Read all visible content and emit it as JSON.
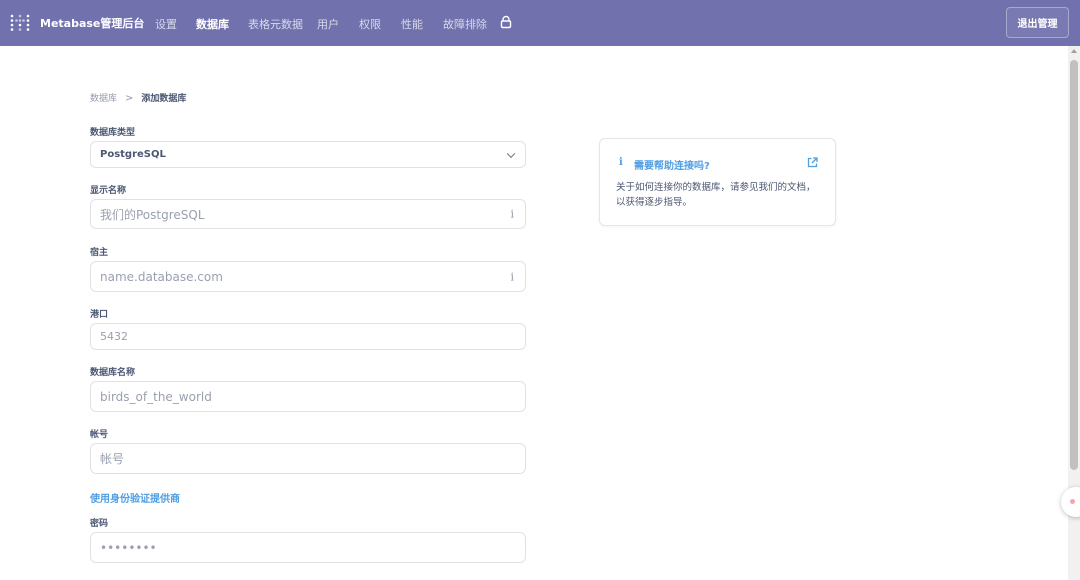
{
  "nav": {
    "brand": "Metabase管理后台",
    "items": [
      {
        "label": "设置",
        "active": false
      },
      {
        "label": "数据库",
        "active": true
      },
      {
        "label": "表格元数据",
        "active": false
      },
      {
        "label": "用户",
        "active": false
      },
      {
        "label": "权限",
        "active": false
      },
      {
        "label": "性能",
        "active": false
      },
      {
        "label": "故障排除",
        "active": false
      }
    ],
    "exit_label": "退出管理",
    "lock_icon": "lock-icon",
    "colors": {
      "nav_bg": "#7172ad",
      "link": "#509ee3"
    }
  },
  "breadcrumb": {
    "parent": "数据库",
    "separator": ">",
    "current": "添加数据库"
  },
  "form": {
    "db_type": {
      "label": "数据库类型",
      "value": "PostgreSQL"
    },
    "display_name": {
      "label": "显示名称",
      "placeholder": "我们的PostgreSQL"
    },
    "host": {
      "label": "宿主",
      "placeholder": "name.database.com"
    },
    "port": {
      "label": "港口",
      "placeholder": "5432"
    },
    "db_name": {
      "label": "数据库名称",
      "placeholder": "birds_of_the_world"
    },
    "username": {
      "label": "帐号",
      "placeholder": "帐号"
    },
    "auth_provider_link": "使用身份验证提供商",
    "password": {
      "label": "密码",
      "placeholder": "••••••••"
    }
  },
  "help": {
    "title": "需要帮助连接吗?",
    "body": "关于如何连接你的数据库，请参见我们的文档，以获得逐步指导。"
  }
}
